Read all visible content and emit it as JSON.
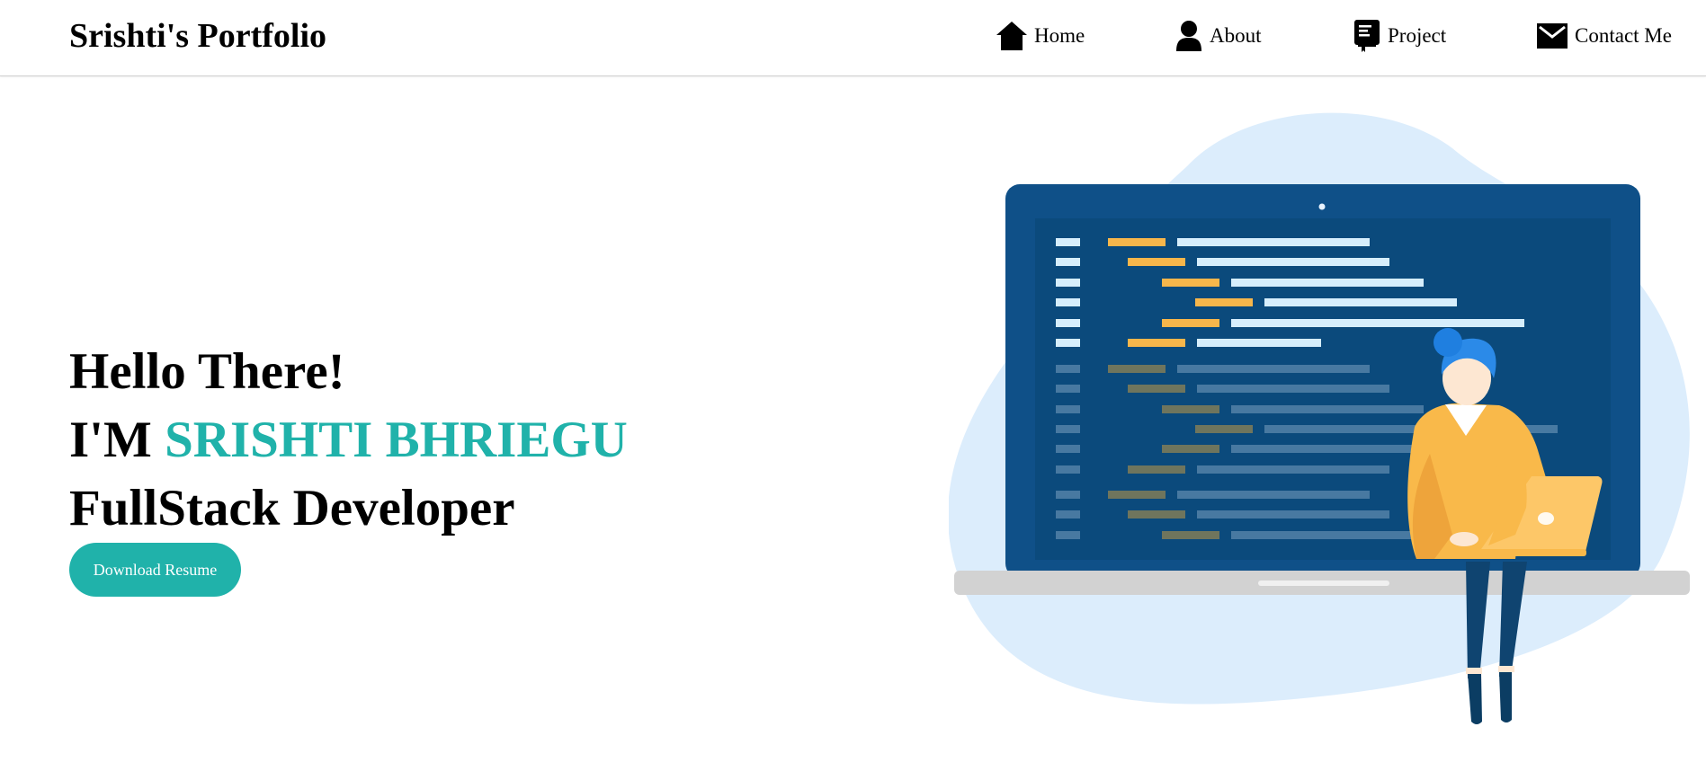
{
  "navbar": {
    "brand": "Srishti's Portfolio",
    "items": [
      {
        "label": "Home",
        "icon": "home-icon"
      },
      {
        "label": "About",
        "icon": "user-icon"
      },
      {
        "label": "Project",
        "icon": "book-icon"
      },
      {
        "label": "Contact Me",
        "icon": "envelope-icon"
      }
    ]
  },
  "hero": {
    "greeting": "Hello There!",
    "intro_prefix": "I'M",
    "name": "SRISHTI BHRIEGU",
    "role": "FullStack Developer",
    "button_label": "Download Resume"
  },
  "colors": {
    "accent": "#20b2aa",
    "laptop_frame": "#0f5088",
    "screen": "#0b4a7c",
    "blob": "#dcedfc",
    "code_orange": "#f7b64b",
    "code_light": "#d6eefc",
    "shirt": "#f9b94a",
    "hair": "#2b8ae8"
  },
  "illustration": {
    "name": "developer-at-laptop-illustration"
  }
}
